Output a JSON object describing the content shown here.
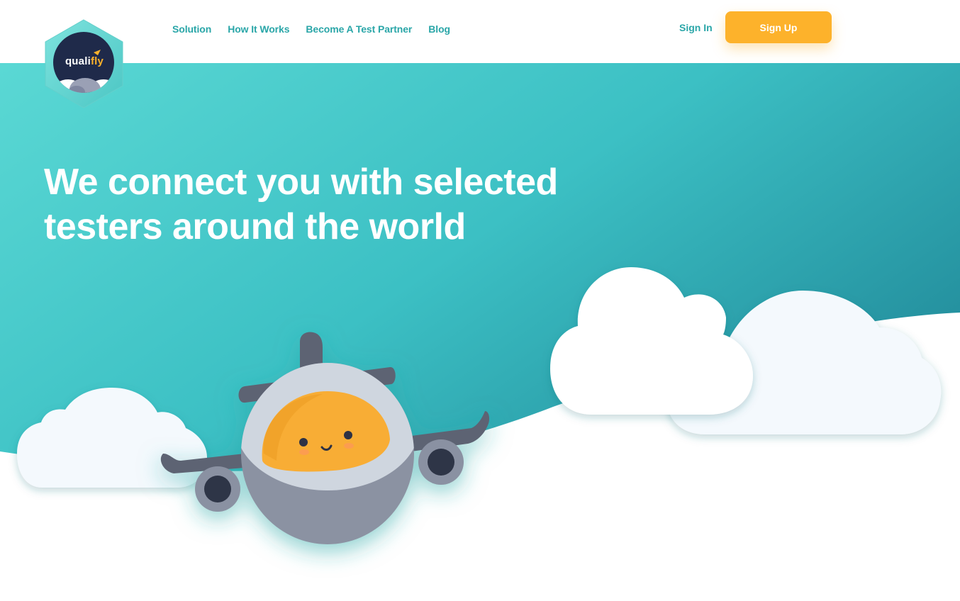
{
  "brand": {
    "name_part1": "quali",
    "name_part2": "fly",
    "logo_icon": "hexagon-plane-logo-icon"
  },
  "nav": {
    "links": [
      {
        "label": "Solution"
      },
      {
        "label": "How It Works"
      },
      {
        "label": "Become A Test Partner"
      },
      {
        "label": "Blog"
      }
    ],
    "sign_in": "Sign In",
    "sign_up": "Sign Up"
  },
  "hero": {
    "headline": "We connect you with selected testers around the world",
    "illustration": "smiling-airplane-icon",
    "decoration": "cloud-icon"
  },
  "colors": {
    "teal_light": "#5ad8d4",
    "teal_dark": "#2a9aa2",
    "accent_orange": "#fdb22b",
    "nav_text": "#2aa6a8"
  }
}
